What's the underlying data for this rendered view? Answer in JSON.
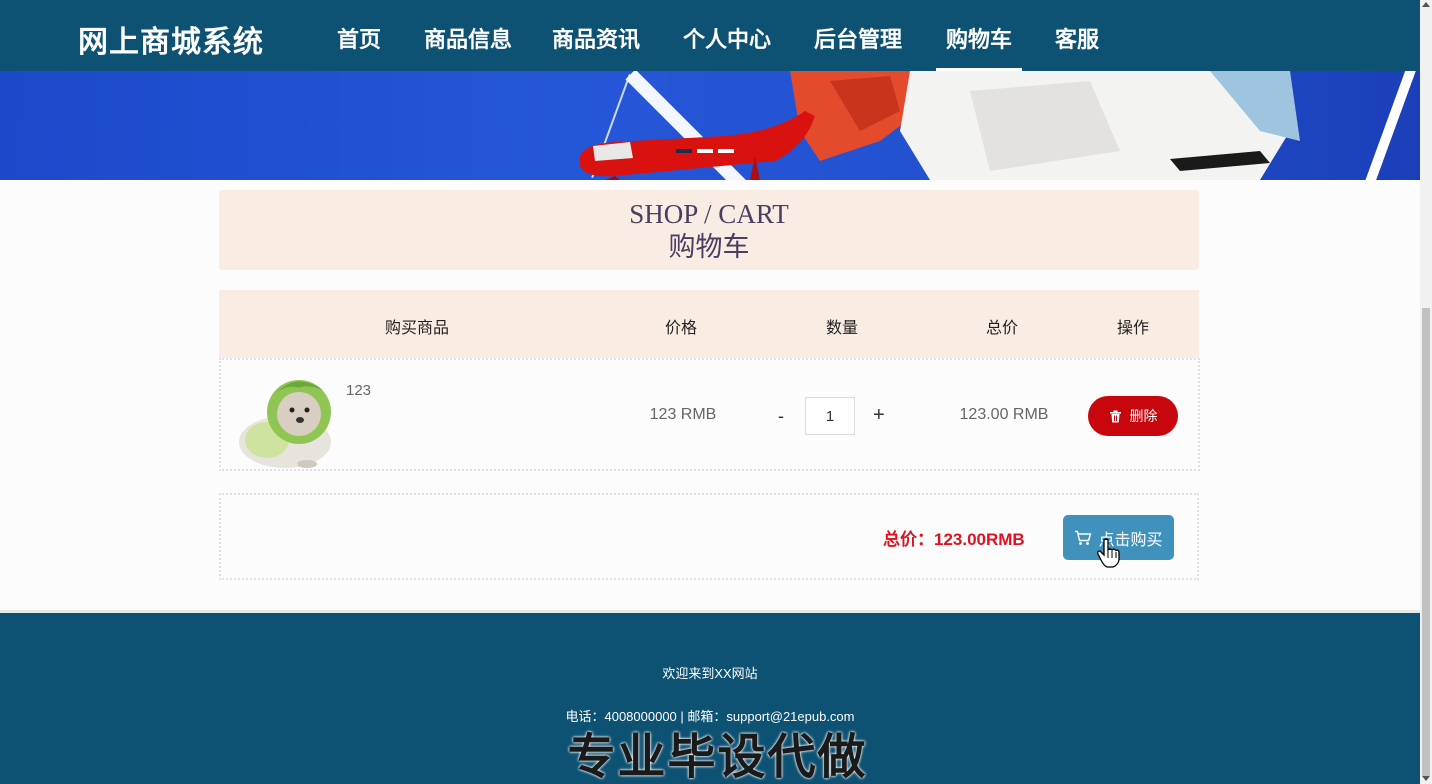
{
  "header": {
    "brand": "网上商城系统",
    "nav": [
      {
        "label": "首页"
      },
      {
        "label": "商品信息"
      },
      {
        "label": "商品资讯"
      },
      {
        "label": "个人中心"
      },
      {
        "label": "后台管理"
      },
      {
        "label": "购物车",
        "active": true
      },
      {
        "label": "客服"
      }
    ]
  },
  "banner": {
    "slides": 3,
    "active_slide": 1
  },
  "page_title": {
    "en": "SHOP / CART",
    "cn": "购物车"
  },
  "cart": {
    "columns": [
      "购买商品",
      "价格",
      "数量",
      "总价",
      "操作"
    ],
    "items": [
      {
        "name": "123",
        "price": "123 RMB",
        "quantity": "1",
        "minus": "-",
        "plus": "+",
        "subtotal": "123.00 RMB",
        "delete_label": "删除"
      }
    ],
    "total": "总价：123.00RMB",
    "buy_label": "点击购买"
  },
  "footer": {
    "welcome": "欢迎来到XX网站",
    "contact": "电话：4008000000 | 邮箱：support@21epub.com",
    "watermark": "专业毕设代做"
  },
  "icons": {
    "delete": "trash-icon",
    "buy": "cart-icon",
    "cursor": "hand-pointer-icon"
  },
  "colors": {
    "header_bg": "#0d5173",
    "panel_bg": "#f9ece3",
    "delete": "#c8060e",
    "buy": "#4191bd",
    "total": "#e2111d"
  }
}
